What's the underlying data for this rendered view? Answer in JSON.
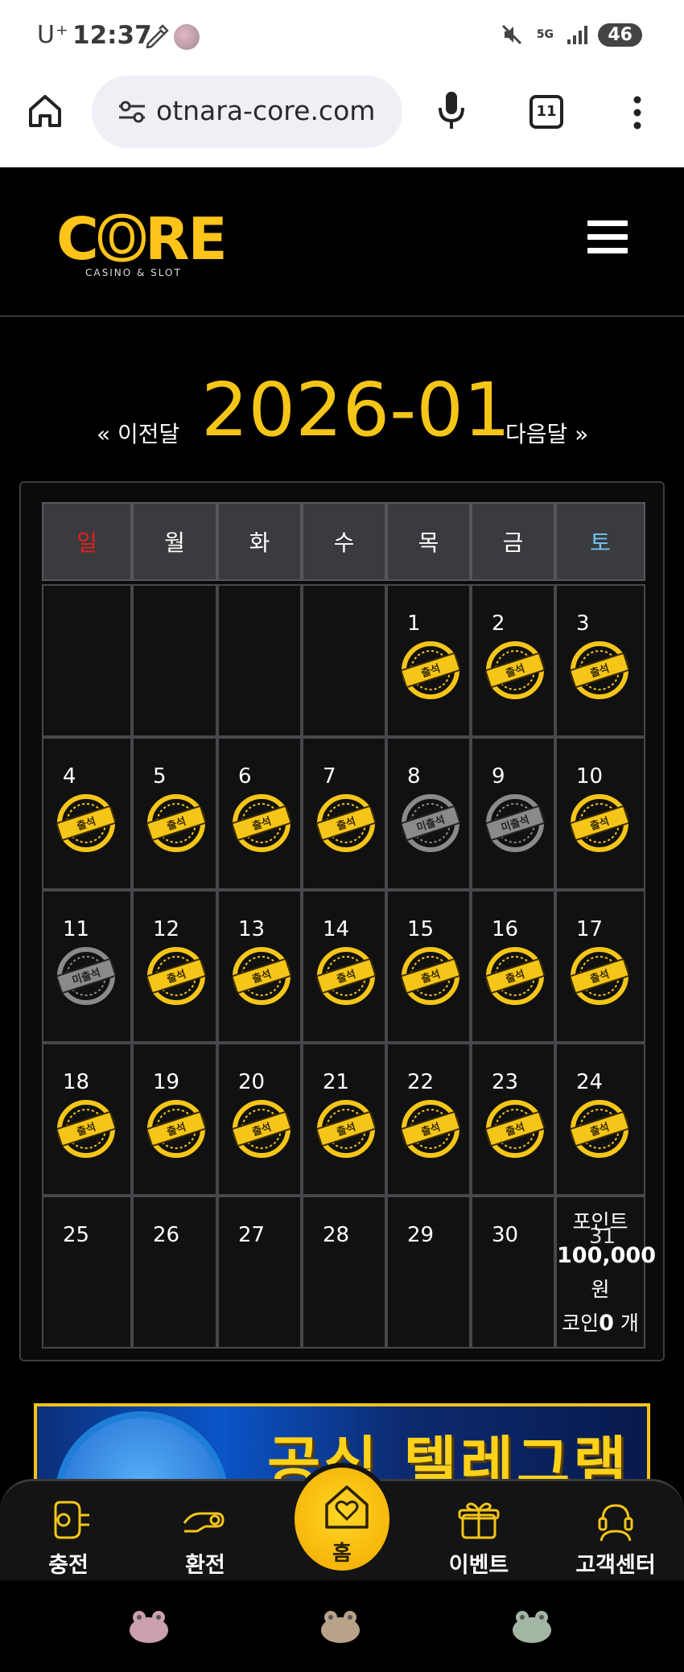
{
  "status_bar": {
    "carrier": "U⁺",
    "time": "12:37",
    "network": "5G",
    "battery": "46"
  },
  "browser": {
    "url": "otnara-core.com",
    "tab_count": "11"
  },
  "header": {
    "logo_text": "CORE",
    "logo_subtitle": "CASINO & SLOT"
  },
  "calendar": {
    "prev_label": "« 이전달",
    "next_label": "다음달 »",
    "month_title": "2026-01",
    "weekdays": [
      "일",
      "월",
      "화",
      "수",
      "목",
      "금",
      "토"
    ],
    "stamp_attended": "출석",
    "stamp_absent": "미출석",
    "days": [
      {
        "day": "1",
        "status": "attended"
      },
      {
        "day": "2",
        "status": "attended"
      },
      {
        "day": "3",
        "status": "attended"
      },
      {
        "day": "4",
        "status": "attended"
      },
      {
        "day": "5",
        "status": "attended"
      },
      {
        "day": "6",
        "status": "attended"
      },
      {
        "day": "7",
        "status": "attended"
      },
      {
        "day": "8",
        "status": "absent"
      },
      {
        "day": "9",
        "status": "absent"
      },
      {
        "day": "10",
        "status": "attended"
      },
      {
        "day": "11",
        "status": "absent"
      },
      {
        "day": "12",
        "status": "attended"
      },
      {
        "day": "13",
        "status": "attended"
      },
      {
        "day": "14",
        "status": "attended"
      },
      {
        "day": "15",
        "status": "attended"
      },
      {
        "day": "16",
        "status": "attended"
      },
      {
        "day": "17",
        "status": "attended"
      },
      {
        "day": "18",
        "status": "attended"
      },
      {
        "day": "19",
        "status": "attended"
      },
      {
        "day": "20",
        "status": "attended"
      },
      {
        "day": "21",
        "status": "attended"
      },
      {
        "day": "22",
        "status": "attended"
      },
      {
        "day": "23",
        "status": "attended"
      },
      {
        "day": "24",
        "status": "attended"
      },
      {
        "day": "25",
        "status": "none"
      },
      {
        "day": "26",
        "status": "none"
      },
      {
        "day": "27",
        "status": "none"
      },
      {
        "day": "28",
        "status": "none"
      },
      {
        "day": "29",
        "status": "none"
      },
      {
        "day": "30",
        "status": "none"
      },
      {
        "day": "31",
        "status": "summary"
      }
    ],
    "summary": {
      "point_label": "포인트",
      "point_value": "100,000",
      "point_unit": "원",
      "coin_label": "코인",
      "coin_value": "0",
      "coin_unit": "개"
    }
  },
  "banner": {
    "text": "공식 텔레그램"
  },
  "bottom_nav": {
    "charge": "충전",
    "exchange": "환전",
    "home": "홈",
    "event": "이벤트",
    "support": "고객센터"
  },
  "colors": {
    "accent_gold": "#f5c518",
    "sunday_red": "#e0201e",
    "saturday_blue": "#6ec5f0",
    "absent_gray": "#8a8a8a"
  }
}
